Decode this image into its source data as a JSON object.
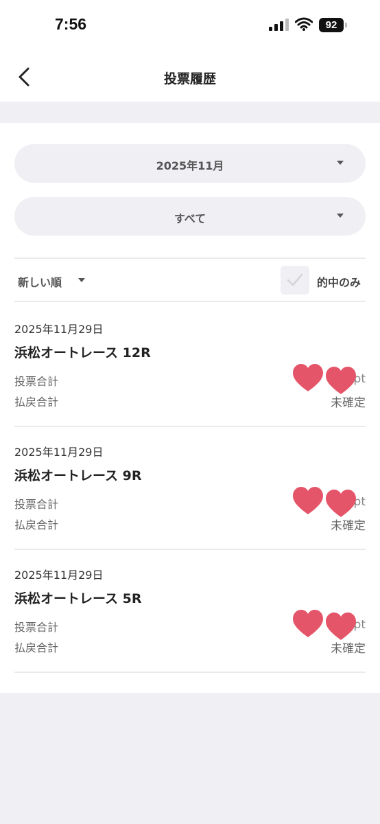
{
  "status_bar": {
    "time": "7:56",
    "battery": "92"
  },
  "nav": {
    "title": "投票履歴"
  },
  "filters": {
    "month": "2025年11月",
    "category": "すべて",
    "sort": "新しい順",
    "hit_only_label": "的中のみ",
    "hit_only_checked": false
  },
  "votes": [
    {
      "date": "2025年11月29日",
      "race": "浜松オートレース 12R",
      "bet_label": "投票合計",
      "bet_value": "pt",
      "payout_label": "払戻合計",
      "payout_value": "未確定"
    },
    {
      "date": "2025年11月29日",
      "race": "浜松オートレース 9R",
      "bet_label": "投票合計",
      "bet_value": "pt",
      "payout_label": "払戻合計",
      "payout_value": "未確定"
    },
    {
      "date": "2025年11月29日",
      "race": "浜松オートレース 5R",
      "bet_label": "投票合計",
      "bet_value": "pt",
      "payout_label": "払戻合計",
      "payout_value": "未確定"
    }
  ],
  "colors": {
    "heart": "#e5556a",
    "pill_bg": "#efeff4",
    "page_bg": "#efeff4"
  }
}
